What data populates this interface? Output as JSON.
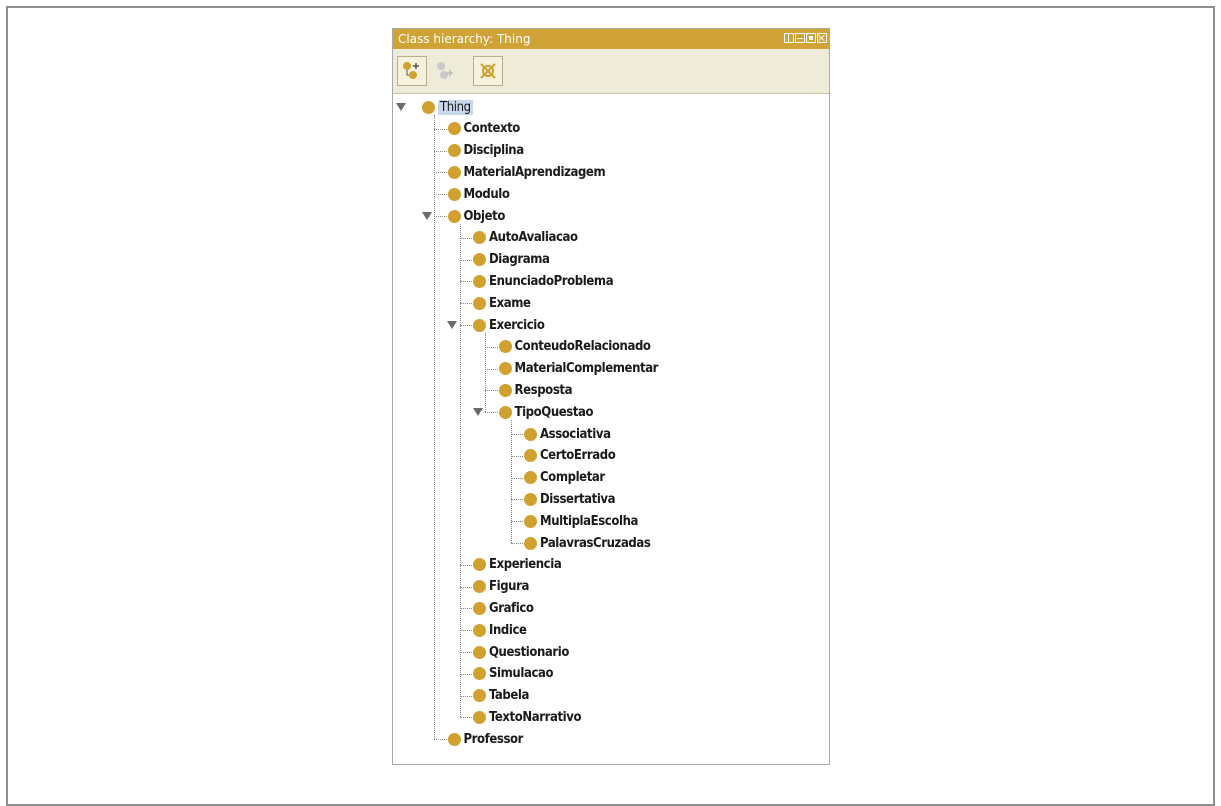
{
  "panel": {
    "title": "Class hierarchy: Thing",
    "accent_color": "#cfa336",
    "toolbar": [
      {
        "name": "add-subclass-icon"
      },
      {
        "name": "add-sibling-icon"
      },
      {
        "name": "delete-class-icon"
      }
    ]
  },
  "tree": {
    "root": "Thing",
    "level1": [
      "Contexto",
      "Disciplina",
      "MaterialAprendizagem",
      "Modulo",
      "Objeto",
      "Professor"
    ],
    "objeto_children_a": [
      "AutoAvaliacao",
      "Diagrama",
      "EnunciadoProblema",
      "Exame",
      "Exercicio"
    ],
    "exercicio_children": [
      "ConteudoRelacionado",
      "MaterialComplementar",
      "Resposta",
      "TipoQuestao"
    ],
    "tipoquestao_children": [
      "Associativa",
      "CertoErrado",
      "Completar",
      "Dissertativa",
      "MultiplaEscolha",
      "PalavrasCruzadas"
    ],
    "objeto_children_b": [
      "Experiencia",
      "Figura",
      "Grafico",
      "Indice",
      "Questionario",
      "Simulacao",
      "Tabela",
      "TextoNarrativo"
    ]
  }
}
